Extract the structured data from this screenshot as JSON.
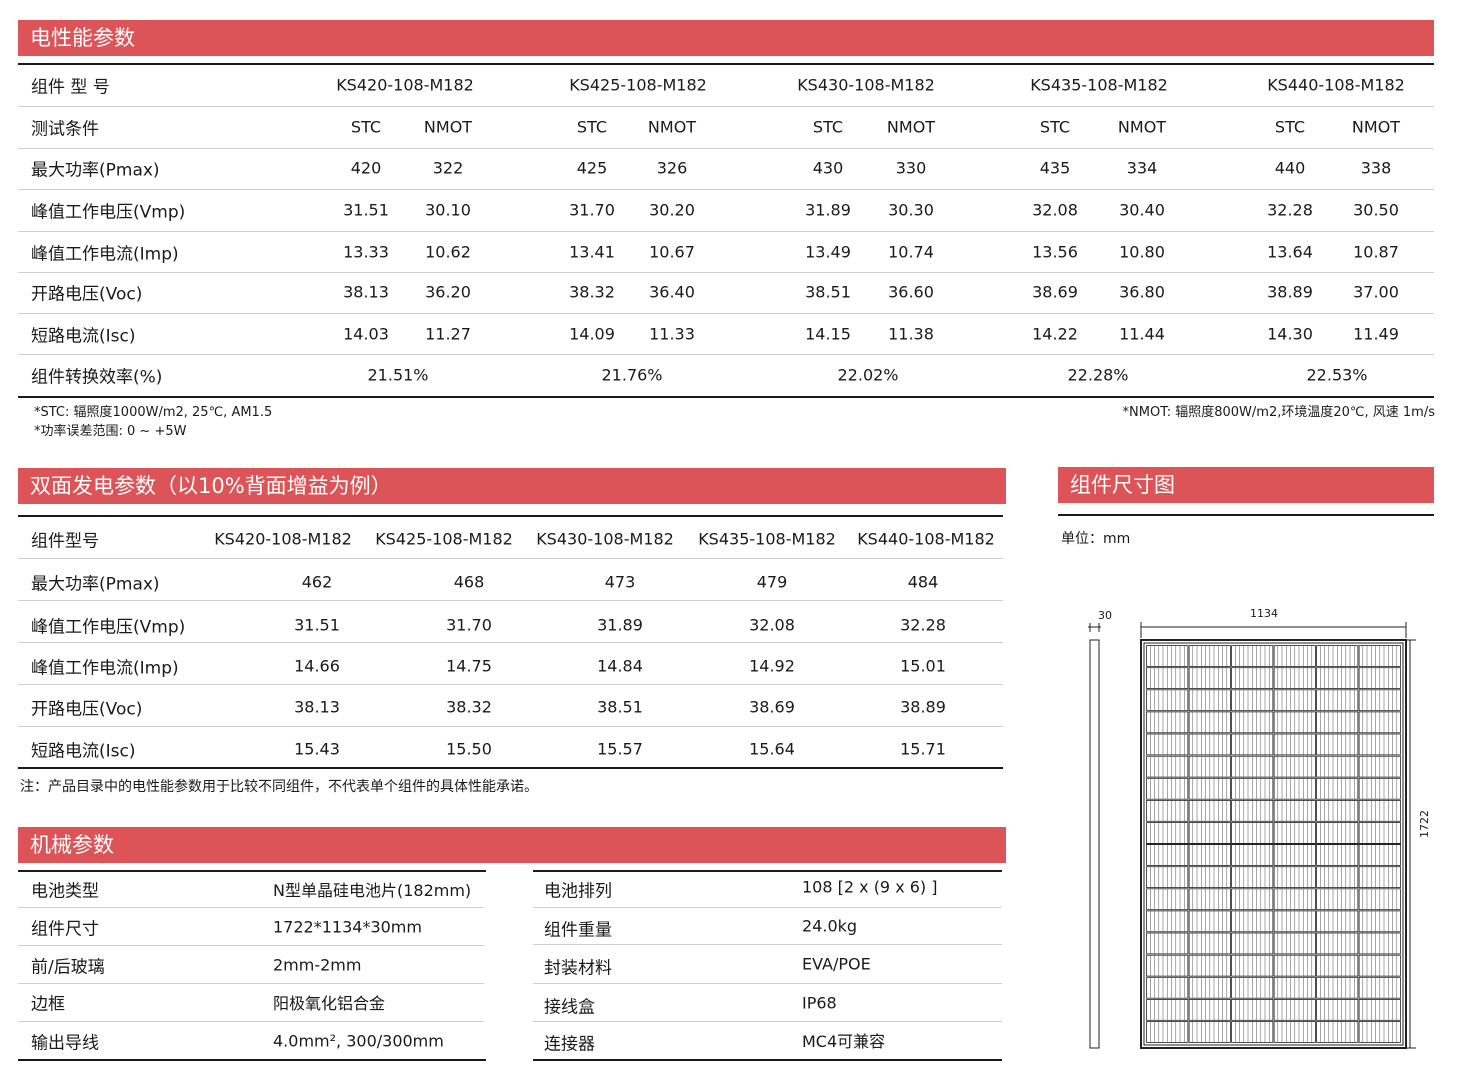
{
  "colors": {
    "accent": "#dc5458",
    "text": "#1a1a1a"
  },
  "electrical": {
    "title": "电性能参数",
    "header": {
      "label": "组件 型 号",
      "models": [
        "KS420-108-M182",
        "KS425-108-M182",
        "KS430-108-M182",
        "KS435-108-M182",
        "KS440-108-M182"
      ]
    },
    "conditions": {
      "label": "测试条件",
      "stc": "STC",
      "nmot": "NMOT"
    },
    "rows": [
      {
        "label": "最大功率(Pmax)",
        "values": [
          "420",
          "322",
          "425",
          "326",
          "430",
          "330",
          "435",
          "334",
          "440",
          "338"
        ]
      },
      {
        "label": "峰值工作电压(Vmp)",
        "values": [
          "31.51",
          "30.10",
          "31.70",
          "30.20",
          "31.89",
          "30.30",
          "32.08",
          "30.40",
          "32.28",
          "30.50"
        ]
      },
      {
        "label": "峰值工作电流(Imp)",
        "values": [
          "13.33",
          "10.62",
          "13.41",
          "10.67",
          "13.49",
          "10.74",
          "13.56",
          "10.80",
          "13.64",
          "10.87"
        ]
      },
      {
        "label": "开路电压(Voc)",
        "values": [
          "38.13",
          "36.20",
          "38.32",
          "36.40",
          "38.51",
          "36.60",
          "38.69",
          "36.80",
          "38.89",
          "37.00"
        ]
      },
      {
        "label": "短路电流(Isc)",
        "values": [
          "14.03",
          "11.27",
          "14.09",
          "11.33",
          "14.15",
          "11.38",
          "14.22",
          "11.44",
          "14.30",
          "11.49"
        ]
      }
    ],
    "efficiency": {
      "label": "组件转换效率(%)",
      "values": [
        "21.51%",
        "21.76%",
        "22.02%",
        "22.28%",
        "22.53%"
      ]
    },
    "notes": {
      "stc": "*STC: 辐照度1000W/m2, 25℃, AM1.5",
      "tolerance": "*功率误差范围: 0 ~ +5W",
      "nmot": "*NMOT: 辐照度800W/m2,环境温度20℃, 风速 1m/s"
    }
  },
  "bifacial": {
    "title": "双面发电参数（以10%背面增益为例）",
    "header": {
      "label": "组件型号",
      "models": [
        "KS420-108-M182",
        "KS425-108-M182",
        "KS430-108-M182",
        "KS435-108-M182",
        "KS440-108-M182"
      ]
    },
    "rows": [
      {
        "label": "最大功率(Pmax)",
        "values": [
          "462",
          "468",
          "473",
          "479",
          "484"
        ]
      },
      {
        "label": "峰值工作电压(Vmp)",
        "values": [
          "31.51",
          "31.70",
          "31.89",
          "32.08",
          "32.28"
        ]
      },
      {
        "label": "峰值工作电流(Imp)",
        "values": [
          "14.66",
          "14.75",
          "14.84",
          "14.92",
          "15.01"
        ]
      },
      {
        "label": "开路电压(Voc)",
        "values": [
          "38.13",
          "38.32",
          "38.51",
          "38.69",
          "38.89"
        ]
      },
      {
        "label": "短路电流(Isc)",
        "values": [
          "15.43",
          "15.50",
          "15.57",
          "15.64",
          "15.71"
        ]
      }
    ],
    "note": "注：产品目录中的电性能参数用于比较不同组件，不代表单个组件的具体性能承诺。"
  },
  "mechanical": {
    "title": "机械参数",
    "left": [
      {
        "label": "电池类型",
        "value": "N型单晶硅电池片(182mm)"
      },
      {
        "label": "组件尺寸",
        "value": "1722*1134*30mm"
      },
      {
        "label": "前/后玻璃",
        "value": "2mm-2mm"
      },
      {
        "label": "边框",
        "value": "阳极氧化铝合金"
      },
      {
        "label": "输出导线",
        "value": "4.0mm², 300/300mm"
      }
    ],
    "right": [
      {
        "label": "电池排列",
        "value": "108 [2 x (9 x 6) ]"
      },
      {
        "label": "组件重量",
        "value": "24.0kg"
      },
      {
        "label": "封装材料",
        "value": "EVA/POE"
      },
      {
        "label": "接线盒",
        "value": "IP68"
      },
      {
        "label": "连接器",
        "value": "MC4可兼容"
      }
    ]
  },
  "dimensions": {
    "title": "组件尺寸图",
    "unit": "单位：mm",
    "thickness": "30",
    "width": "1134",
    "height": "1722"
  }
}
